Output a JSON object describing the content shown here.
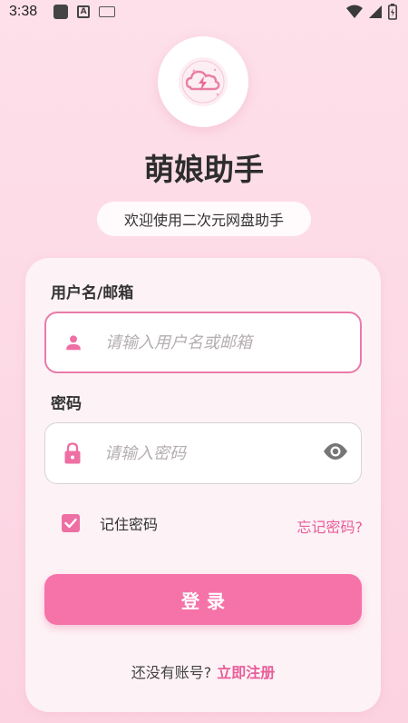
{
  "status_bar": {
    "time": "3:38",
    "input_indicator": "A"
  },
  "app": {
    "title": "萌娘助手",
    "subtitle": "欢迎使用二次元网盘助手"
  },
  "form": {
    "username_label": "用户名/邮箱",
    "username_placeholder": "请输入用户名或邮箱",
    "username_value": "",
    "password_label": "密码",
    "password_placeholder": "请输入密码",
    "password_value": "",
    "remember_label": "记住密码",
    "remember_checked": true,
    "forgot_label": "忘记密码?",
    "login_label": "登录",
    "register_prompt": "还没有账号?",
    "register_link": "立即注册"
  },
  "icons": {
    "logo": "cloud-lightning-icon",
    "username": "person-icon",
    "password": "lock-icon",
    "visibility": "eye-icon",
    "checkbox": "check-icon"
  },
  "colors": {
    "accent": "#f573a9",
    "link": "#e85d9a",
    "icon_pink": "#ee6fa4",
    "background_top": "#fde0ea",
    "card": "#fdf2f5"
  }
}
